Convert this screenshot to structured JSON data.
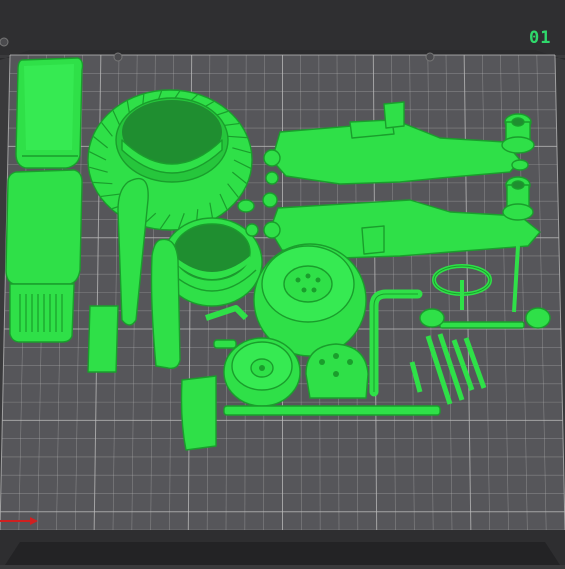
{
  "scene": {
    "plate_number": "01",
    "colors": {
      "background": "#3a3a3c",
      "plate": "#56565a",
      "grid": "#bdbdbd",
      "model": "#2fe048",
      "model_shadow": "#1a9e2c",
      "label": "#2fd86b",
      "x_axis": "#d02020"
    },
    "parts": [
      {
        "name": "hood-top"
      },
      {
        "name": "hood-grille"
      },
      {
        "name": "rear-tire"
      },
      {
        "name": "front-tire"
      },
      {
        "name": "fender-left"
      },
      {
        "name": "fender-right"
      },
      {
        "name": "chassis-rail-upper"
      },
      {
        "name": "chassis-rail-lower"
      },
      {
        "name": "rear-wheel-rim"
      },
      {
        "name": "front-wheel-rim"
      },
      {
        "name": "seat"
      },
      {
        "name": "steering-wheel"
      },
      {
        "name": "exhaust-pipe"
      },
      {
        "name": "axle-rod"
      },
      {
        "name": "small-wrenches"
      }
    ]
  }
}
